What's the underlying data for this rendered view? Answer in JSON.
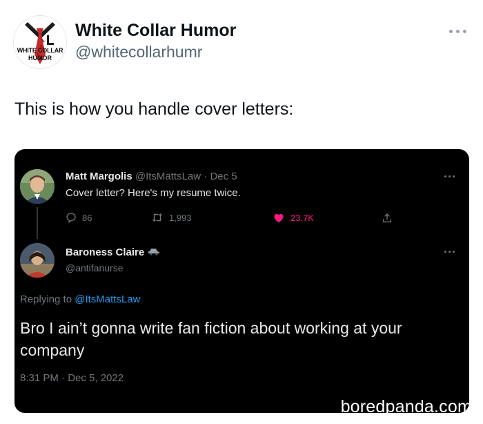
{
  "author": {
    "display_name": "White Collar Humor",
    "handle": "@whitecollarhumr",
    "logo_line1": "WHITE COLLAR",
    "logo_line2": "HUMOR"
  },
  "tweet_text": "This is how you handle cover letters:",
  "embedded_screenshot": {
    "tweet": {
      "name": "Matt Margolis",
      "handle": "@ItsMattsLaw",
      "date_sep": "· Dec 5",
      "text": "Cover letter? Here's my resume twice.",
      "replies": "86",
      "retweets": "1,993",
      "likes": "23.7K"
    },
    "reply": {
      "name": "Baroness Claire",
      "handle": "@antifanurse",
      "replying_to_label": "Replying to",
      "replying_to_handle": "@ItsMattsLaw",
      "text": "Bro I ain’t gonna write fan fiction about working at your company",
      "timestamp": "8:31 PM · Dec 5, 2022"
    }
  },
  "watermark": "boredpanda.com",
  "colors": {
    "like_pink": "#f91880",
    "link_blue": "#1d9bf0",
    "muted_gray": "#71767b"
  }
}
